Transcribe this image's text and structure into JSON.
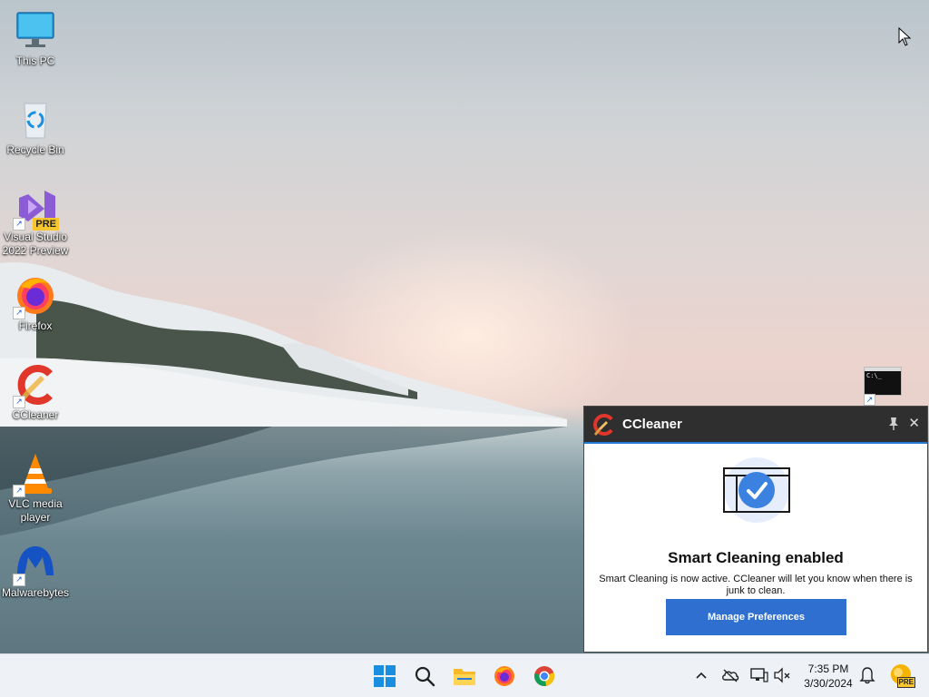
{
  "desktop": {
    "icons": [
      {
        "label": "This PC",
        "icon": "monitor-icon"
      },
      {
        "label": "Recycle Bin",
        "icon": "recycle-bin-icon"
      },
      {
        "label": "Visual Studio 2022 Preview",
        "icon": "visual-studio-icon",
        "badge": "PRE"
      },
      {
        "label": "Firefox",
        "icon": "firefox-icon"
      },
      {
        "label": "CCleaner",
        "icon": "ccleaner-icon"
      },
      {
        "label": "VLC media player",
        "icon": "vlc-icon"
      },
      {
        "label": "Malwarebytes",
        "icon": "malwarebytes-icon"
      }
    ],
    "cmd_icon": {
      "text": "C:\\_"
    }
  },
  "notification": {
    "app_name": "CCleaner",
    "heading": "Smart Cleaning enabled",
    "body": "Smart Cleaning is now active. CCleaner will let you know when there is junk to clean.",
    "button_label": "Manage Preferences",
    "accent_color": "#2f6fcf"
  },
  "taskbar": {
    "apps": [
      "start-icon",
      "search-icon",
      "file-explorer-icon",
      "firefox-icon",
      "chrome-icon"
    ],
    "tray": [
      "chevron-up-icon",
      "onedrive-offline-icon",
      "display-icon",
      "volume-muted-icon"
    ],
    "time": "7:35 PM",
    "date": "3/30/2024",
    "badge": "PRE"
  }
}
